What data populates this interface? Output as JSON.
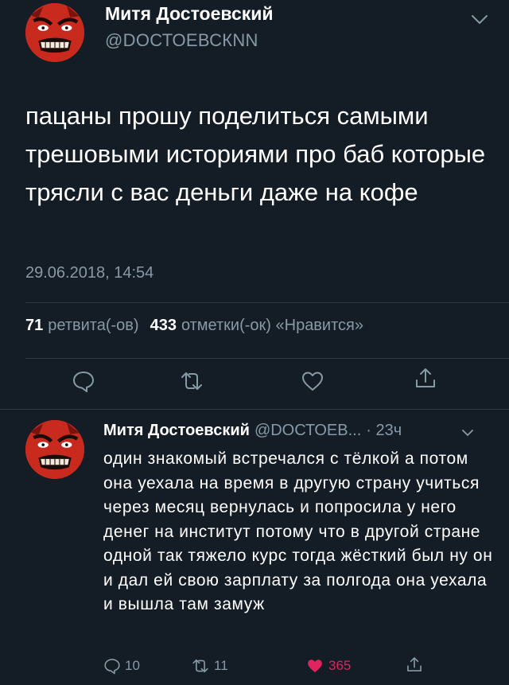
{
  "tweet": {
    "author_name": "Митя Достоевский",
    "author_handle": "@DОСТОЕВСКNN",
    "text": "пацаны прошу поделиться самыми трешовыми историями про баб которые трясли с вас деньги даже на кофе",
    "timestamp": "29.06.2018, 14:54",
    "retweets_count": "71",
    "retweets_label": "ретвита(-ов)",
    "likes_count": "433",
    "likes_label": "отметки(-ок) «Нравится»"
  },
  "reply": {
    "author_name": "Митя Достоевский",
    "author_handle": "@DОСТОЕВ...",
    "age": "· 23ч",
    "text": "один знакомый встречался с тёлкой а потом она уехала на время в другую страну учиться через месяц вернулась и попросила у него денег на институт потому что в другой стране одной так тяжело курс тогда жёсткий был ну он и дал ей свою зарплату за полгода она уехала и вышла там замуж",
    "replies": "10",
    "retweets": "11",
    "likes": "365"
  },
  "icons": {
    "reply": "reply-icon",
    "retweet": "retweet-icon",
    "like": "heart-icon",
    "share": "share-icon",
    "menu": "chevron-down-icon"
  },
  "colors": {
    "background": "#141d26",
    "muted": "#8899a6",
    "like_active": "#e0245e",
    "avatar": "#c92a1e"
  }
}
